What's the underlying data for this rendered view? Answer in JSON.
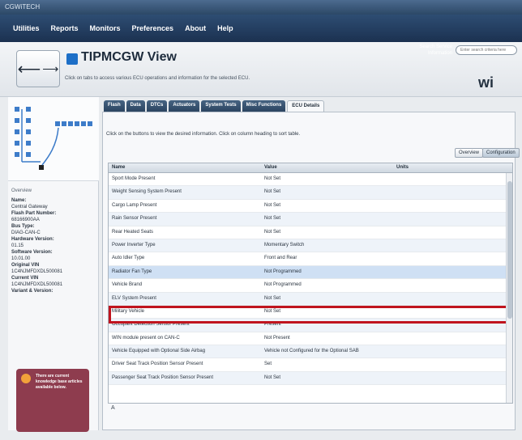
{
  "window": {
    "title": "CGWiTECH"
  },
  "menu": [
    "Utilities",
    "Reports",
    "Monitors",
    "Preferences",
    "About",
    "Help"
  ],
  "header": {
    "title": "TIPMCGW View",
    "subtitle": "Click on tabs to access various ECU operations and information for the selected ECU.",
    "search_label": "Search Service Information",
    "search_placeholder": "Enter search criteria here",
    "logo_text": "wi"
  },
  "tabs": [
    "Flash",
    "Data",
    "DTCs",
    "Actuators",
    "System Tests",
    "Misc Functions",
    "ECU Details"
  ],
  "content": {
    "instruction": "Click on the buttons to view the desired information. Click on column heading to sort table.",
    "btn_overview": "Overview",
    "btn_config": "Configuration"
  },
  "left": {
    "overview": "Overview",
    "fields": [
      {
        "label": "Name:",
        "value": "Central Gateway"
      },
      {
        "label": "Flash Part Number:",
        "value": "68166900AA"
      },
      {
        "label": "Bus Type:",
        "value": "DIAG-CAN-C"
      },
      {
        "label": "Hardware Version:",
        "value": "01.15"
      },
      {
        "label": "Software Version:",
        "value": "10.01.00"
      },
      {
        "label": "Original VIN",
        "value": "1C4NJMFDXDL500081"
      },
      {
        "label": "Current VIN",
        "value": "1C4NJMFDXDL500081"
      },
      {
        "label": "Variant & Version:",
        "value": ""
      }
    ],
    "popup": "There are current knowledge base articles available below."
  },
  "table": {
    "headers": [
      "Name",
      "Value",
      "Units"
    ],
    "rows": [
      {
        "name": "Sport Mode Present",
        "value": "Not Set"
      },
      {
        "name": "Weight Sensing System Present",
        "value": "Not Set"
      },
      {
        "name": "Cargo Lamp Present",
        "value": "Not Set"
      },
      {
        "name": "Rain Sensor Present",
        "value": "Not Set"
      },
      {
        "name": "Rear Heated Seats",
        "value": "Not Set"
      },
      {
        "name": "Power Inverter Type",
        "value": "Momentary Switch"
      },
      {
        "name": "Auto Idler Type",
        "value": "Front and Rear"
      },
      {
        "name": "Radiator Fan Type",
        "value": "Not Programmed"
      },
      {
        "name": "Vehicle Brand",
        "value": "Not Programmed"
      },
      {
        "name": "ELV System Present",
        "value": "Not Set"
      },
      {
        "name": "Military Vehicle",
        "value": "Not Set"
      },
      {
        "name": "Occupant Detection Sensor Present",
        "value": "Present"
      },
      {
        "name": "WIN module present on CAN-C",
        "value": "Not Present"
      },
      {
        "name": "Vehicle Equipped with Optional Side Airbag",
        "value": "Vehicle not Configured for the Optional SAB"
      },
      {
        "name": "Driver Seat Track Position Sensor Present",
        "value": "Set"
      },
      {
        "name": "Passenger Seat Track Position Sensor Present",
        "value": "Not Set"
      }
    ],
    "footer": "A"
  }
}
